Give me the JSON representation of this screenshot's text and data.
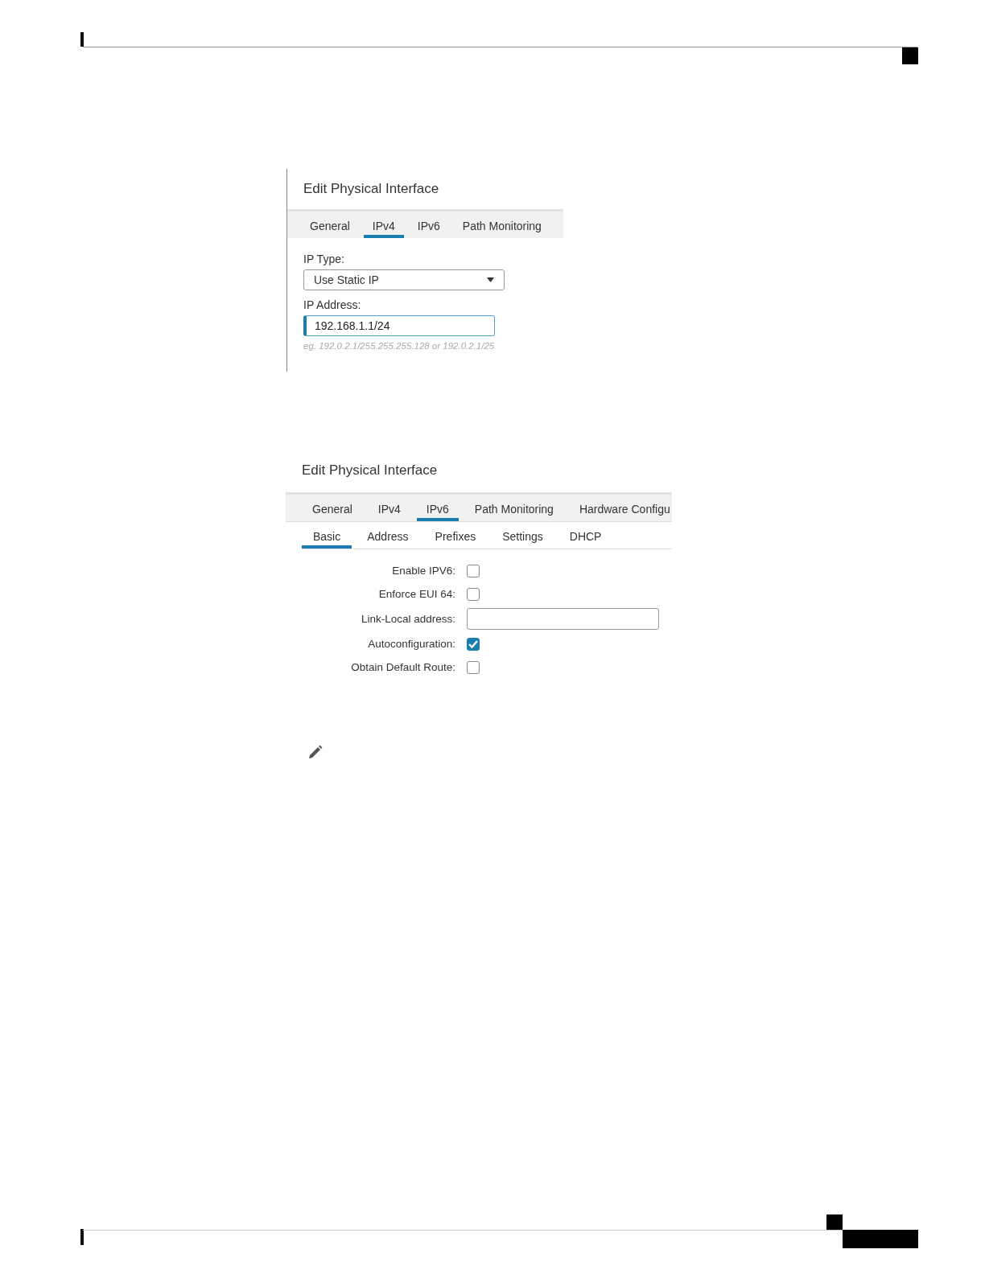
{
  "dialog_ipv4": {
    "title": "Edit Physical Interface",
    "tabs": [
      {
        "label": "General",
        "selected": false
      },
      {
        "label": "IPv4",
        "selected": true
      },
      {
        "label": "IPv6",
        "selected": false
      },
      {
        "label": "Path Monitoring",
        "selected": false
      }
    ],
    "ip_type": {
      "label": "IP Type:",
      "value": "Use Static IP"
    },
    "ip_address": {
      "label": "IP Address:",
      "value": "192.168.1.1/24",
      "focused": true,
      "hint": "eg. 192.0.2.1/255.255.255.128 or 192.0.2.1/25"
    }
  },
  "dialog_ipv6": {
    "title": "Edit Physical Interface",
    "tabs": [
      {
        "label": "General",
        "selected": false
      },
      {
        "label": "IPv4",
        "selected": false
      },
      {
        "label": "IPv6",
        "selected": true
      },
      {
        "label": "Path Monitoring",
        "selected": false
      },
      {
        "label": "Hardware Configu",
        "selected": false
      }
    ],
    "subtabs": [
      {
        "label": "Basic",
        "selected": true
      },
      {
        "label": "Address",
        "selected": false
      },
      {
        "label": "Prefixes",
        "selected": false
      },
      {
        "label": "Settings",
        "selected": false
      },
      {
        "label": "DHCP",
        "selected": false
      }
    ],
    "fields": [
      {
        "kind": "checkbox",
        "label": "Enable IPV6:",
        "checked": false
      },
      {
        "kind": "checkbox",
        "label": "Enforce EUI 64:",
        "checked": false
      },
      {
        "kind": "text",
        "label": "Link-Local address:"
      },
      {
        "kind": "checkbox",
        "label": "Autoconfiguration:",
        "checked": true
      },
      {
        "kind": "checkbox",
        "label": "Obtain Default Route:",
        "checked": false
      }
    ]
  }
}
